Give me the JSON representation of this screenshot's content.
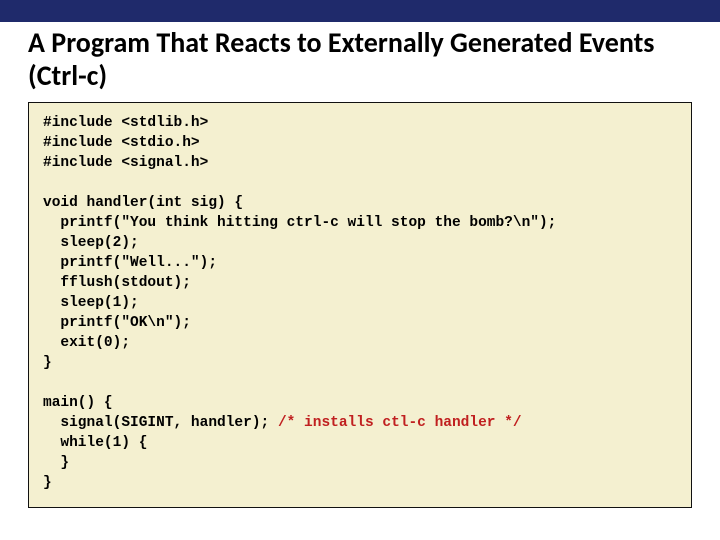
{
  "title": "A Program That Reacts to Externally Generated Events (Ctrl-c)",
  "code": {
    "includes": [
      "#include <stdlib.h>",
      "#include <stdio.h>",
      "#include <signal.h>"
    ],
    "handler": [
      "void handler(int sig) {",
      "  printf(\"You think hitting ctrl-c will stop the bomb?\\n\");",
      "  sleep(2);",
      "  printf(\"Well...\");",
      "  fflush(stdout);",
      "  sleep(1);",
      "  printf(\"OK\\n\");",
      "  exit(0);",
      "}"
    ],
    "main_pre": [
      "main() {",
      "  signal(SIGINT, handler); "
    ],
    "main_comment": "/* installs ctl-c handler */",
    "main_post": [
      "  while(1) {",
      "  }",
      "}"
    ]
  }
}
